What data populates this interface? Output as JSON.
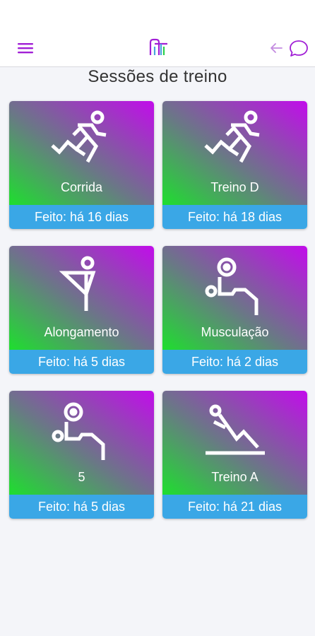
{
  "header": {
    "menu_icon": "hamburger-menu-icon",
    "logo_icon": "app-logo-icon",
    "back_icon": "arrow-left-icon",
    "chat_icon": "chat-bubble-icon",
    "accent_color": "#a11fd6"
  },
  "page": {
    "title": "Sessões de treino"
  },
  "cards": [
    {
      "title": "Corrida",
      "footer": "Feito: há 16 dias",
      "icon": "running-icon"
    },
    {
      "title": "Treino D",
      "footer": "Feito: há 18 dias",
      "icon": "running-icon"
    },
    {
      "title": "Alongamento",
      "footer": "Feito: há 5 dias",
      "icon": "stretching-icon"
    },
    {
      "title": "Musculação",
      "footer": "Feito: há 2 dias",
      "icon": "weightlifting-icon"
    },
    {
      "title": "5",
      "footer": "Feito: há 5 dias",
      "icon": "weightlifting-icon"
    },
    {
      "title": "Treino A",
      "footer": "Feito: há 21 dias",
      "icon": "situp-icon"
    }
  ],
  "colors": {
    "gradient_green": "#1edf2e",
    "gradient_purple": "#c20ceb",
    "footer_blue": "#3aa7e6"
  }
}
